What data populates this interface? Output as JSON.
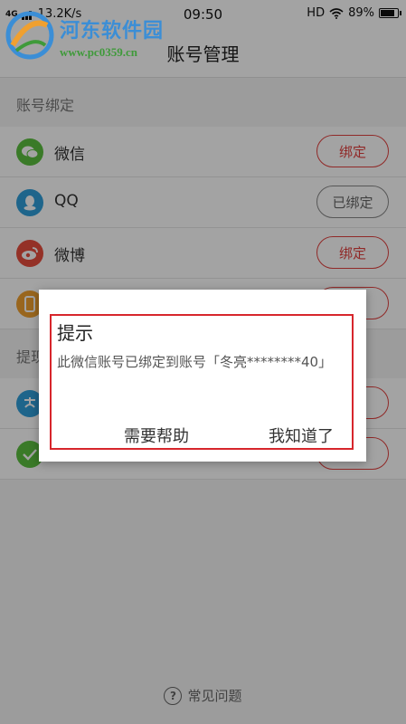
{
  "status_bar": {
    "network": "4G",
    "speed": "13.2K/s",
    "time": "09:50",
    "hd": "HD",
    "battery": "89%",
    "battery_level": 0.89
  },
  "watermark": {
    "title": "河东软件园",
    "url": "www.pc0359.cn"
  },
  "nav": {
    "title": "账号管理"
  },
  "sections": [
    {
      "header": "账号绑定"
    },
    {
      "header": "提现"
    }
  ],
  "accounts": [
    {
      "icon": "wechat-icon",
      "label": "微信",
      "button": "绑定",
      "bound": false,
      "color": "#5cbf3f"
    },
    {
      "icon": "qq-icon",
      "label": "QQ",
      "button": "已绑定",
      "bound": true,
      "color": "#2f9ed9"
    },
    {
      "icon": "weibo-icon",
      "label": "微博",
      "button": "绑定",
      "bound": false,
      "color": "#e84d3d"
    },
    {
      "icon": "phone-icon",
      "label": "",
      "button": "",
      "bound": false,
      "color": "#f0a030"
    }
  ],
  "withdraw": [
    {
      "icon": "alipay-icon",
      "color": "#2f9ed9"
    },
    {
      "icon": "wechat-pay-icon",
      "color": "#5cbf3f"
    }
  ],
  "footer": {
    "help": "常见问题"
  },
  "dialog": {
    "title": "提示",
    "message": "此微信账号已绑定到账号「冬亮********40」",
    "help_button": "需要帮助",
    "ok_button": "我知道了"
  },
  "colors": {
    "accent": "#e2413f",
    "highlight": "#d7262c"
  }
}
